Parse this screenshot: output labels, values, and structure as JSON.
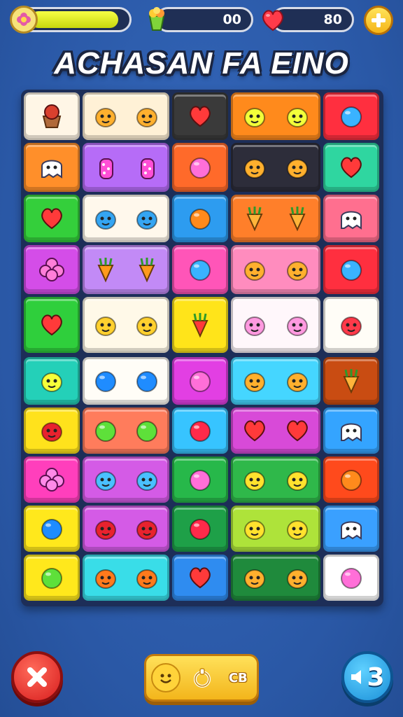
{
  "hud": {
    "energy_fill_percent": 85,
    "score": "00",
    "lives": "80",
    "icons": [
      "flower-icon",
      "candy-icon",
      "heart-icon",
      "plus-icon"
    ]
  },
  "title": "ACHASAN FA EINO",
  "board": {
    "rows": [
      [
        "cupcake-icon",
        "monster-icon",
        "heart-icon",
        "dino-icon",
        "blob-icon"
      ],
      [
        "ghost-icon",
        "mushroom-icon",
        "gem-icon",
        "monster-icon",
        "heart-icon"
      ],
      [
        "heart-icon",
        "bird-icon",
        "orange-icon",
        "cone-icon",
        "ghost-icon"
      ],
      [
        "star-icon",
        "carrot-icon",
        "blob-icon",
        "monster-icon",
        "blob-icon"
      ],
      [
        "heart-icon",
        "candy-icon",
        "radish-icon",
        "pig-icon",
        "bear-icon"
      ],
      [
        "frog-icon",
        "ball-icon",
        "gem-icon",
        "monster-icon",
        "cone-icon"
      ],
      [
        "strawberry-icon",
        "apple-icon",
        "berry-icon",
        "heart-icon",
        "cloud-icon"
      ],
      [
        "flower-icon",
        "leaf-icon",
        "gem-icon",
        "lizard-icon",
        "orange-icon"
      ],
      [
        "ball-icon",
        "strawberry-icon",
        "berry-icon",
        "lizard-icon",
        "ghost-icon"
      ],
      [
        "apple-icon",
        "bean-icon",
        "heart-icon",
        "monster-icon",
        "gem-icon"
      ]
    ]
  },
  "controls": {
    "close_icon": "close-icon",
    "tray_icons": [
      "smile-icon",
      "refresh-icon",
      "cb-icon"
    ],
    "tray_label": "CB",
    "sound_label": "3",
    "sound_icon": "speaker-icon"
  }
}
